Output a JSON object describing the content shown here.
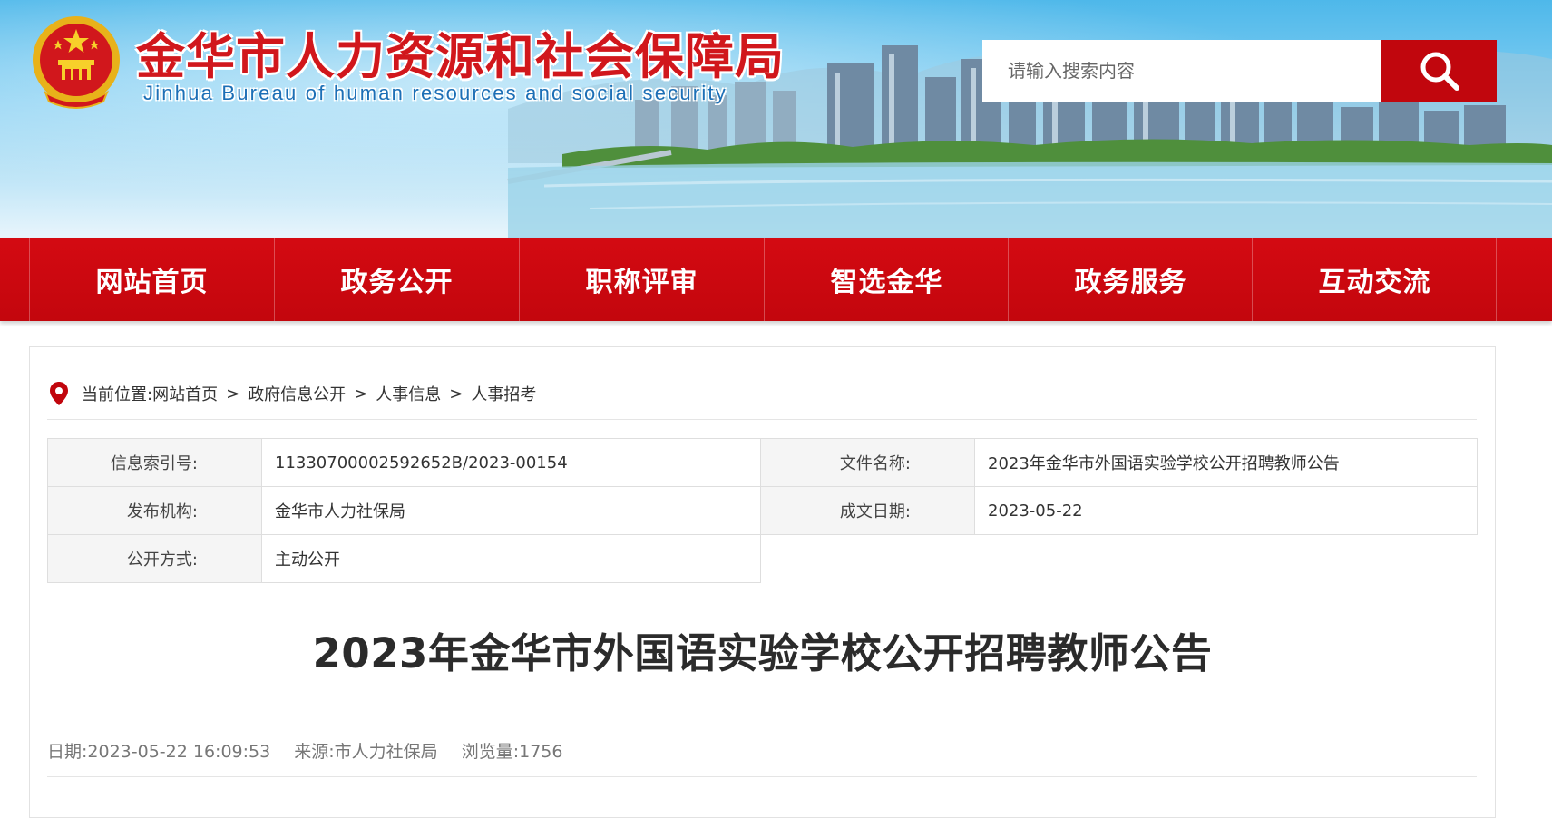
{
  "header": {
    "site_title": "金华市人力资源和社会保障局",
    "site_subtitle": "Jinhua Bureau of human resources and social security",
    "search_placeholder": "请输入搜索内容"
  },
  "colors": {
    "brand_red": "#c1060d",
    "title_red": "#d1171c",
    "subtitle_blue": "#1c6fb6"
  },
  "icons": {
    "emblem": "national-emblem-icon",
    "search": "search-icon",
    "location": "location-pin-icon"
  },
  "nav": {
    "items": [
      {
        "label": "网站首页"
      },
      {
        "label": "政务公开"
      },
      {
        "label": "职称评审"
      },
      {
        "label": "智选金华"
      },
      {
        "label": "政务服务"
      },
      {
        "label": "互动交流"
      }
    ]
  },
  "breadcrumb": {
    "prefix": "当前位置:",
    "items": [
      {
        "label": "网站首页"
      },
      {
        "label": "政府信息公开"
      },
      {
        "label": "人事信息"
      },
      {
        "label": "人事招考"
      }
    ],
    "separator": ">"
  },
  "info": {
    "index_no_label": "信息索引号:",
    "index_no": "11330700002592652B/2023-00154",
    "doc_name_label": "文件名称:",
    "doc_name": "2023年金华市外国语实验学校公开招聘教师公告",
    "publisher_label": "发布机构:",
    "publisher": "金华市人力社保局",
    "date_label": "成文日期:",
    "date": "2023-05-22",
    "disclosure_label": "公开方式:",
    "disclosure": "主动公开"
  },
  "article": {
    "title": "2023年金华市外国语实验学校公开招聘教师公告",
    "date_text": "日期:2023-05-22 16:09:53",
    "source_text": "来源:市人力社保局",
    "views_text": "浏览量:1756"
  }
}
